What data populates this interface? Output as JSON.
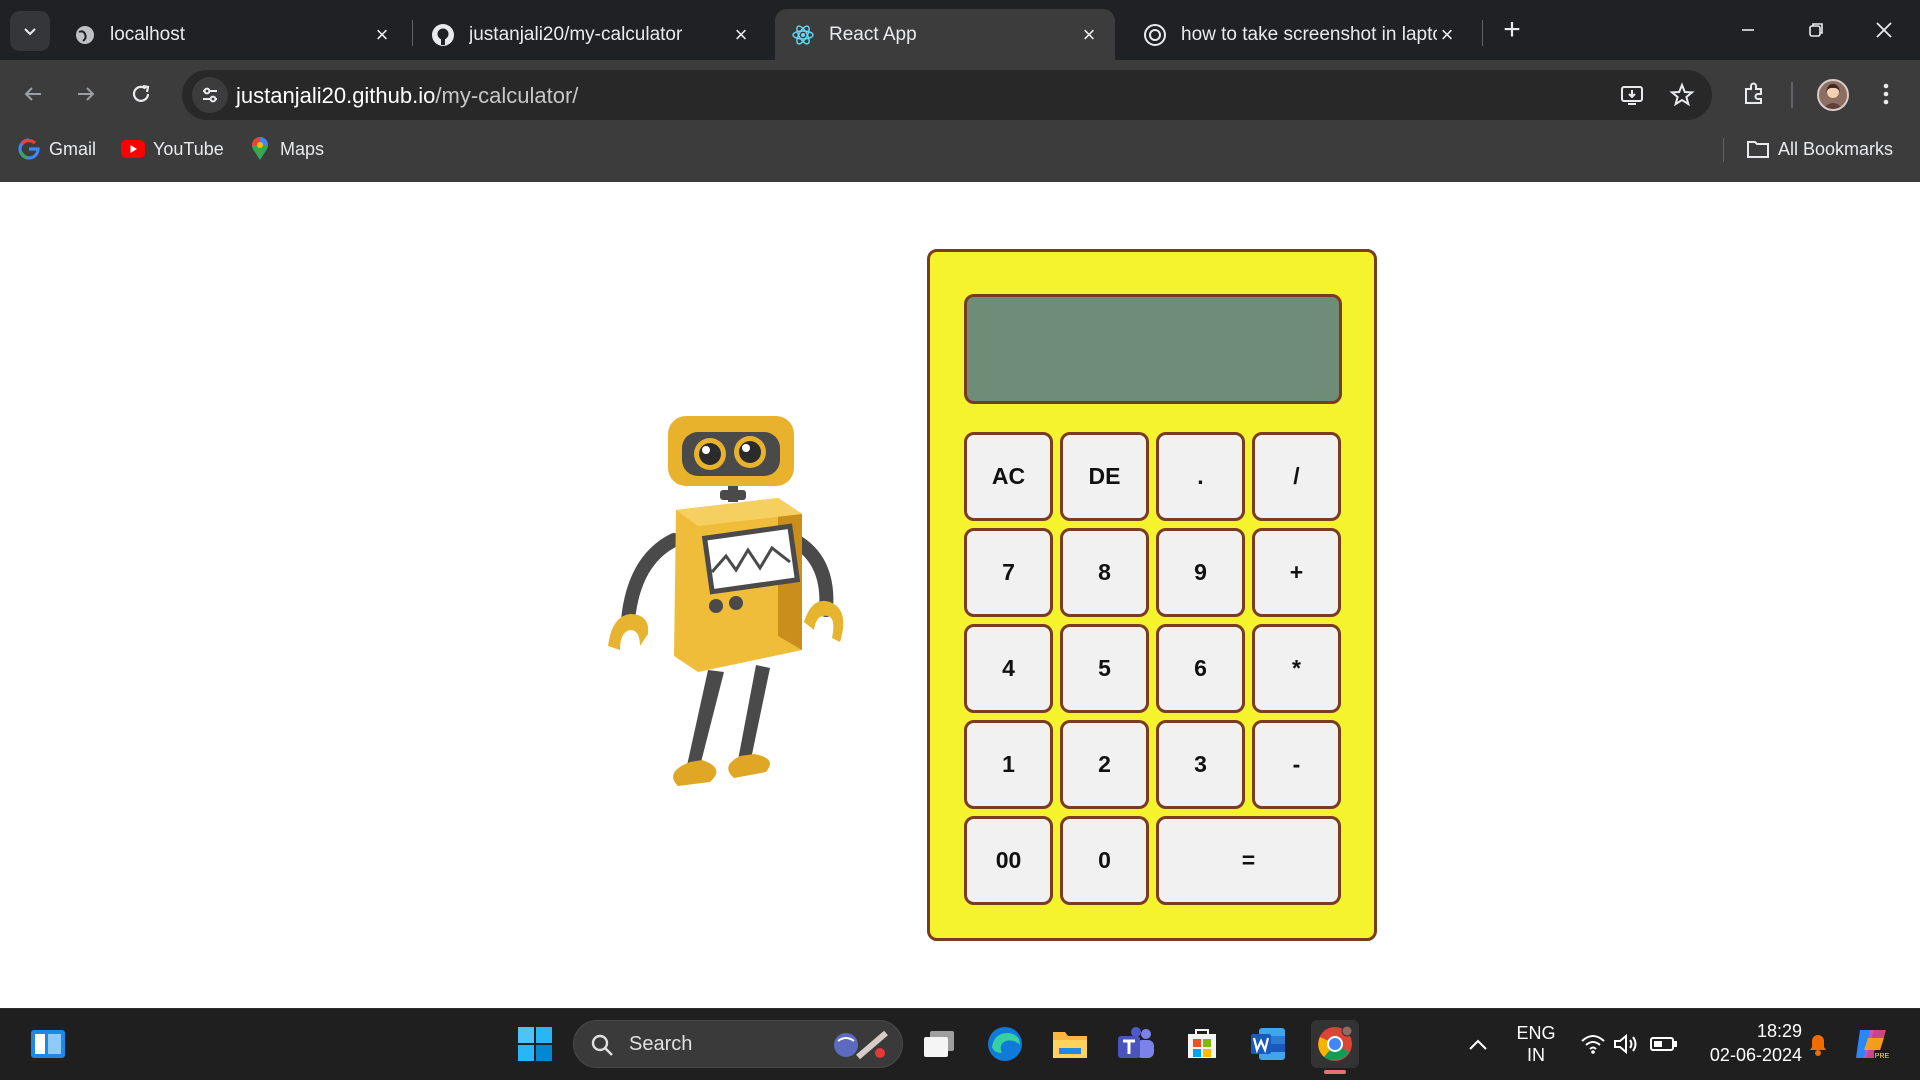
{
  "browser": {
    "tabs": [
      {
        "title": "localhost",
        "icon": "globe-icon",
        "active": false
      },
      {
        "title": "justanjali20/my-calculator",
        "icon": "github-icon",
        "active": false
      },
      {
        "title": "React App",
        "icon": "react-icon",
        "active": true
      },
      {
        "title": "how to take screenshot in lapto",
        "icon": "google-search-icon",
        "active": false
      }
    ],
    "url_host": "justanjali20.github.io",
    "url_path": "/my-calculator/",
    "bookmarks": [
      {
        "label": "Gmail",
        "icon": "google-icon"
      },
      {
        "label": "YouTube",
        "icon": "youtube-icon"
      },
      {
        "label": "Maps",
        "icon": "maps-pin-icon"
      }
    ],
    "all_bookmarks_label": "All Bookmarks"
  },
  "calculator": {
    "display_value": "",
    "colors": {
      "body": "#f5f22e",
      "border": "#7a3b1e",
      "display": "#6e8c78",
      "key": "#f1f1f1"
    },
    "rows": [
      [
        "AC",
        "DE",
        ".",
        "/"
      ],
      [
        "7",
        "8",
        "9",
        "+"
      ],
      [
        "4",
        "5",
        "6",
        "*"
      ],
      [
        "1",
        "2",
        "3",
        "-"
      ],
      [
        "00",
        "0",
        "="
      ]
    ]
  },
  "taskbar": {
    "search_label": "Search",
    "language_top": "ENG",
    "language_bottom": "IN",
    "time": "18:29",
    "date": "02-06-2024"
  }
}
